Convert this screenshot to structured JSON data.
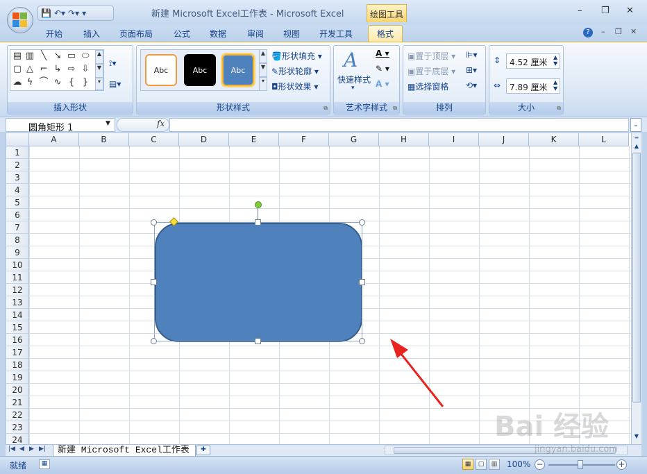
{
  "window": {
    "title": "新建 Microsoft Excel工作表 - Microsoft Excel",
    "context_tab_header": "绘图工具",
    "controls": [
      "–",
      "❐",
      "✕"
    ]
  },
  "tabs": [
    {
      "label": "开始"
    },
    {
      "label": "插入"
    },
    {
      "label": "页面布局"
    },
    {
      "label": "公式"
    },
    {
      "label": "数据"
    },
    {
      "label": "审阅"
    },
    {
      "label": "视图"
    },
    {
      "label": "开发工具"
    },
    {
      "label": "格式"
    }
  ],
  "active_tab": "格式",
  "ribbon": {
    "insert_shapes": {
      "label": "插入形状"
    },
    "shape_styles": {
      "label": "形状样式",
      "samples": [
        "Abc",
        "Abc",
        "Abc"
      ],
      "fill": "形状填充",
      "outline": "形状轮廓",
      "effects": "形状效果"
    },
    "wordart_styles": {
      "label": "艺术字样式",
      "quick_styles": "快速样式"
    },
    "arrange": {
      "label": "排列",
      "bring_to_front": "置于顶层",
      "send_to_back": "置于底层",
      "selection_pane": "选择窗格"
    },
    "size": {
      "label": "大小",
      "height": "4.52 厘米",
      "width": "7.89 厘米"
    }
  },
  "formula_bar": {
    "name_box": "圆角矩形 1",
    "fx": "fx",
    "formula": ""
  },
  "columns": [
    "A",
    "B",
    "C",
    "D",
    "E",
    "F",
    "G",
    "H",
    "I",
    "J",
    "K",
    "L"
  ],
  "rows": [
    "1",
    "2",
    "3",
    "4",
    "5",
    "6",
    "7",
    "8",
    "9",
    "10",
    "11",
    "12",
    "13",
    "14",
    "15",
    "16",
    "17",
    "18",
    "19",
    "20",
    "21",
    "22",
    "23",
    "24"
  ],
  "shape": {
    "name": "圆角矩形 1",
    "fill": "#4f81bd",
    "outline": "#385d8a"
  },
  "sheet_tabs": [
    {
      "label": "新建 Microsoft Excel工作表"
    }
  ],
  "status": {
    "ready": "就绪",
    "zoom": "100%"
  },
  "colors": {
    "accent": "#4f81bd",
    "context_tab": "#f7d46f",
    "arrow": "#e8231f"
  },
  "watermark": {
    "text": "Bai 经验",
    "sub": "jingyan.baidu.com"
  }
}
